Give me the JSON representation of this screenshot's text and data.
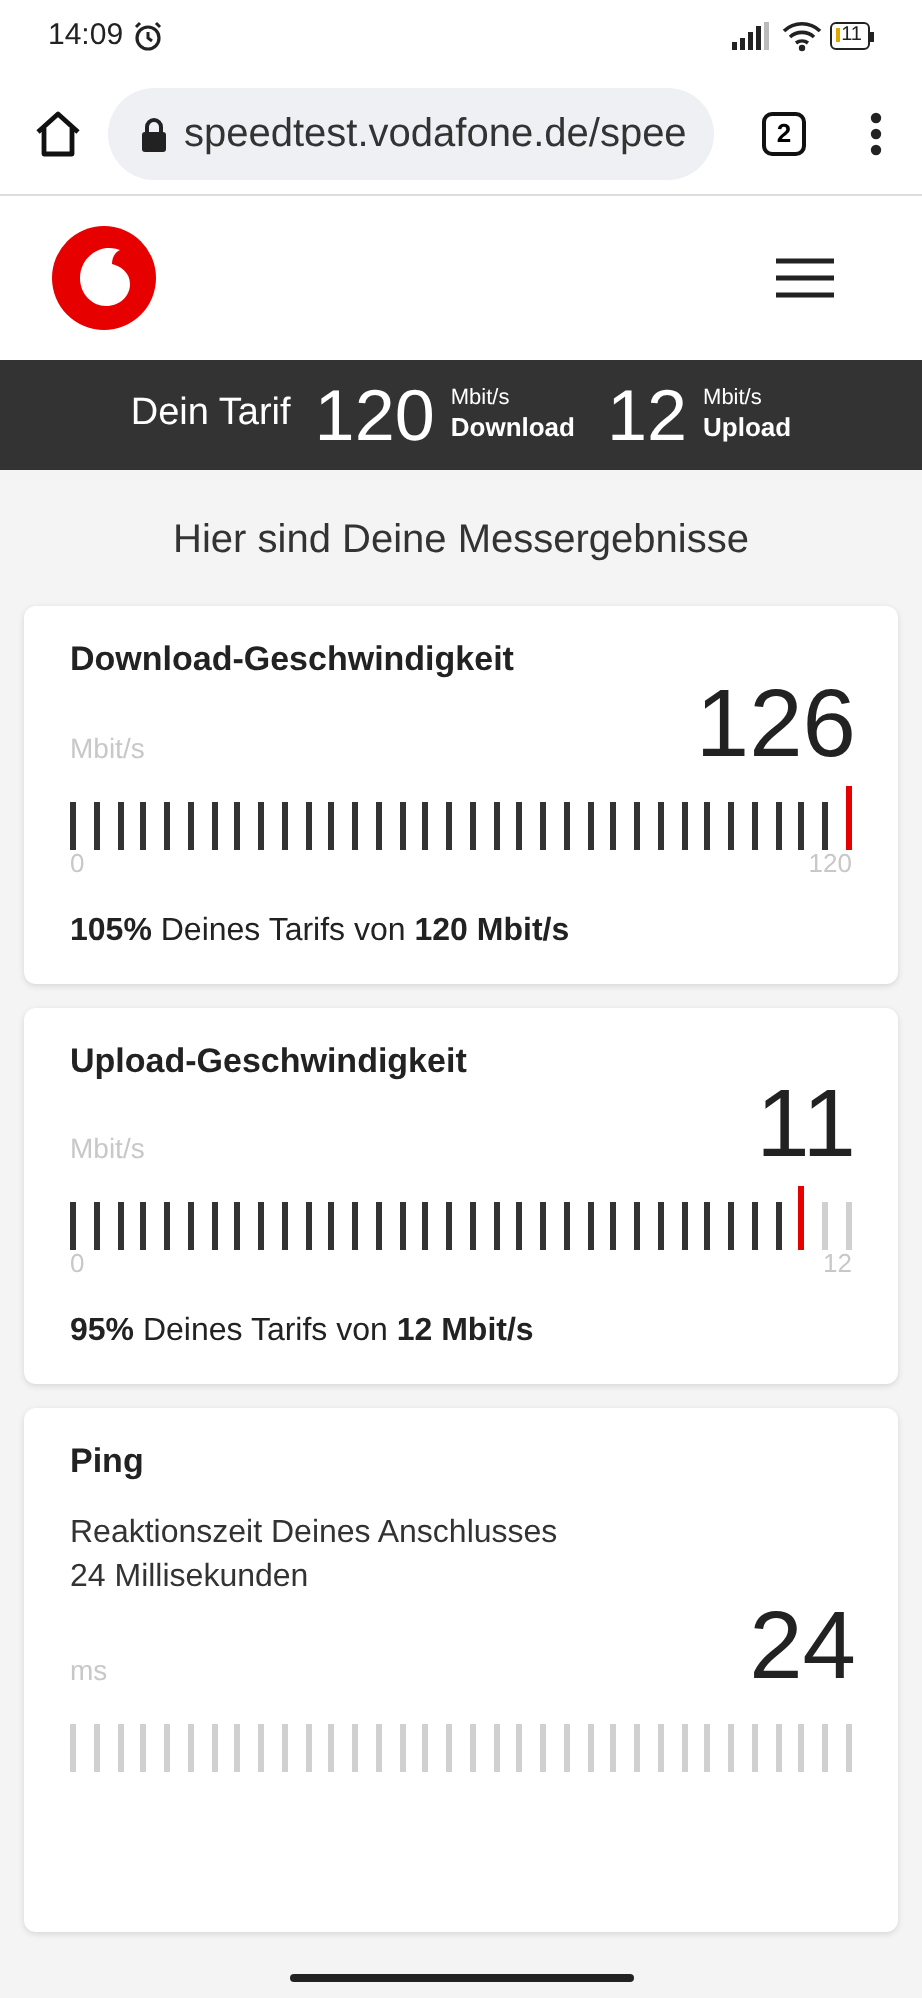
{
  "status_bar": {
    "time": "14:09",
    "battery": "11"
  },
  "browser": {
    "url": "speedtest.vodafone.de/spee",
    "tab_count": "2"
  },
  "tariff_bar": {
    "label": "Dein Tarif",
    "download_value": "120",
    "download_unit": "Mbit/s",
    "download_label": "Download",
    "upload_value": "12",
    "upload_unit": "Mbit/s",
    "upload_label": "Upload"
  },
  "heading": "Hier sind Deine Messergebnisse",
  "results": [
    {
      "title": "Download-Geschwindigkeit",
      "value": "126",
      "unit": "Mbit/s",
      "level": 1,
      "scale_min": "0",
      "scale_max": "120",
      "summary": "**105%** Deines Tarifs von **120 Mbit/s**"
    },
    {
      "title": "Upload-Geschwindigkeit",
      "value": "11",
      "unit": "Mbit/s",
      "level": 0.94,
      "scale_min": "0",
      "scale_max": "12",
      "summary": "**95%** Deines Tarifs von **12 Mbit/s**"
    },
    {
      "title": "Ping",
      "description": [
        "Reaktionszeit Deines Anschlusses",
        "24 Millisekunden"
      ],
      "value": "24",
      "unit": "ms"
    }
  ]
}
